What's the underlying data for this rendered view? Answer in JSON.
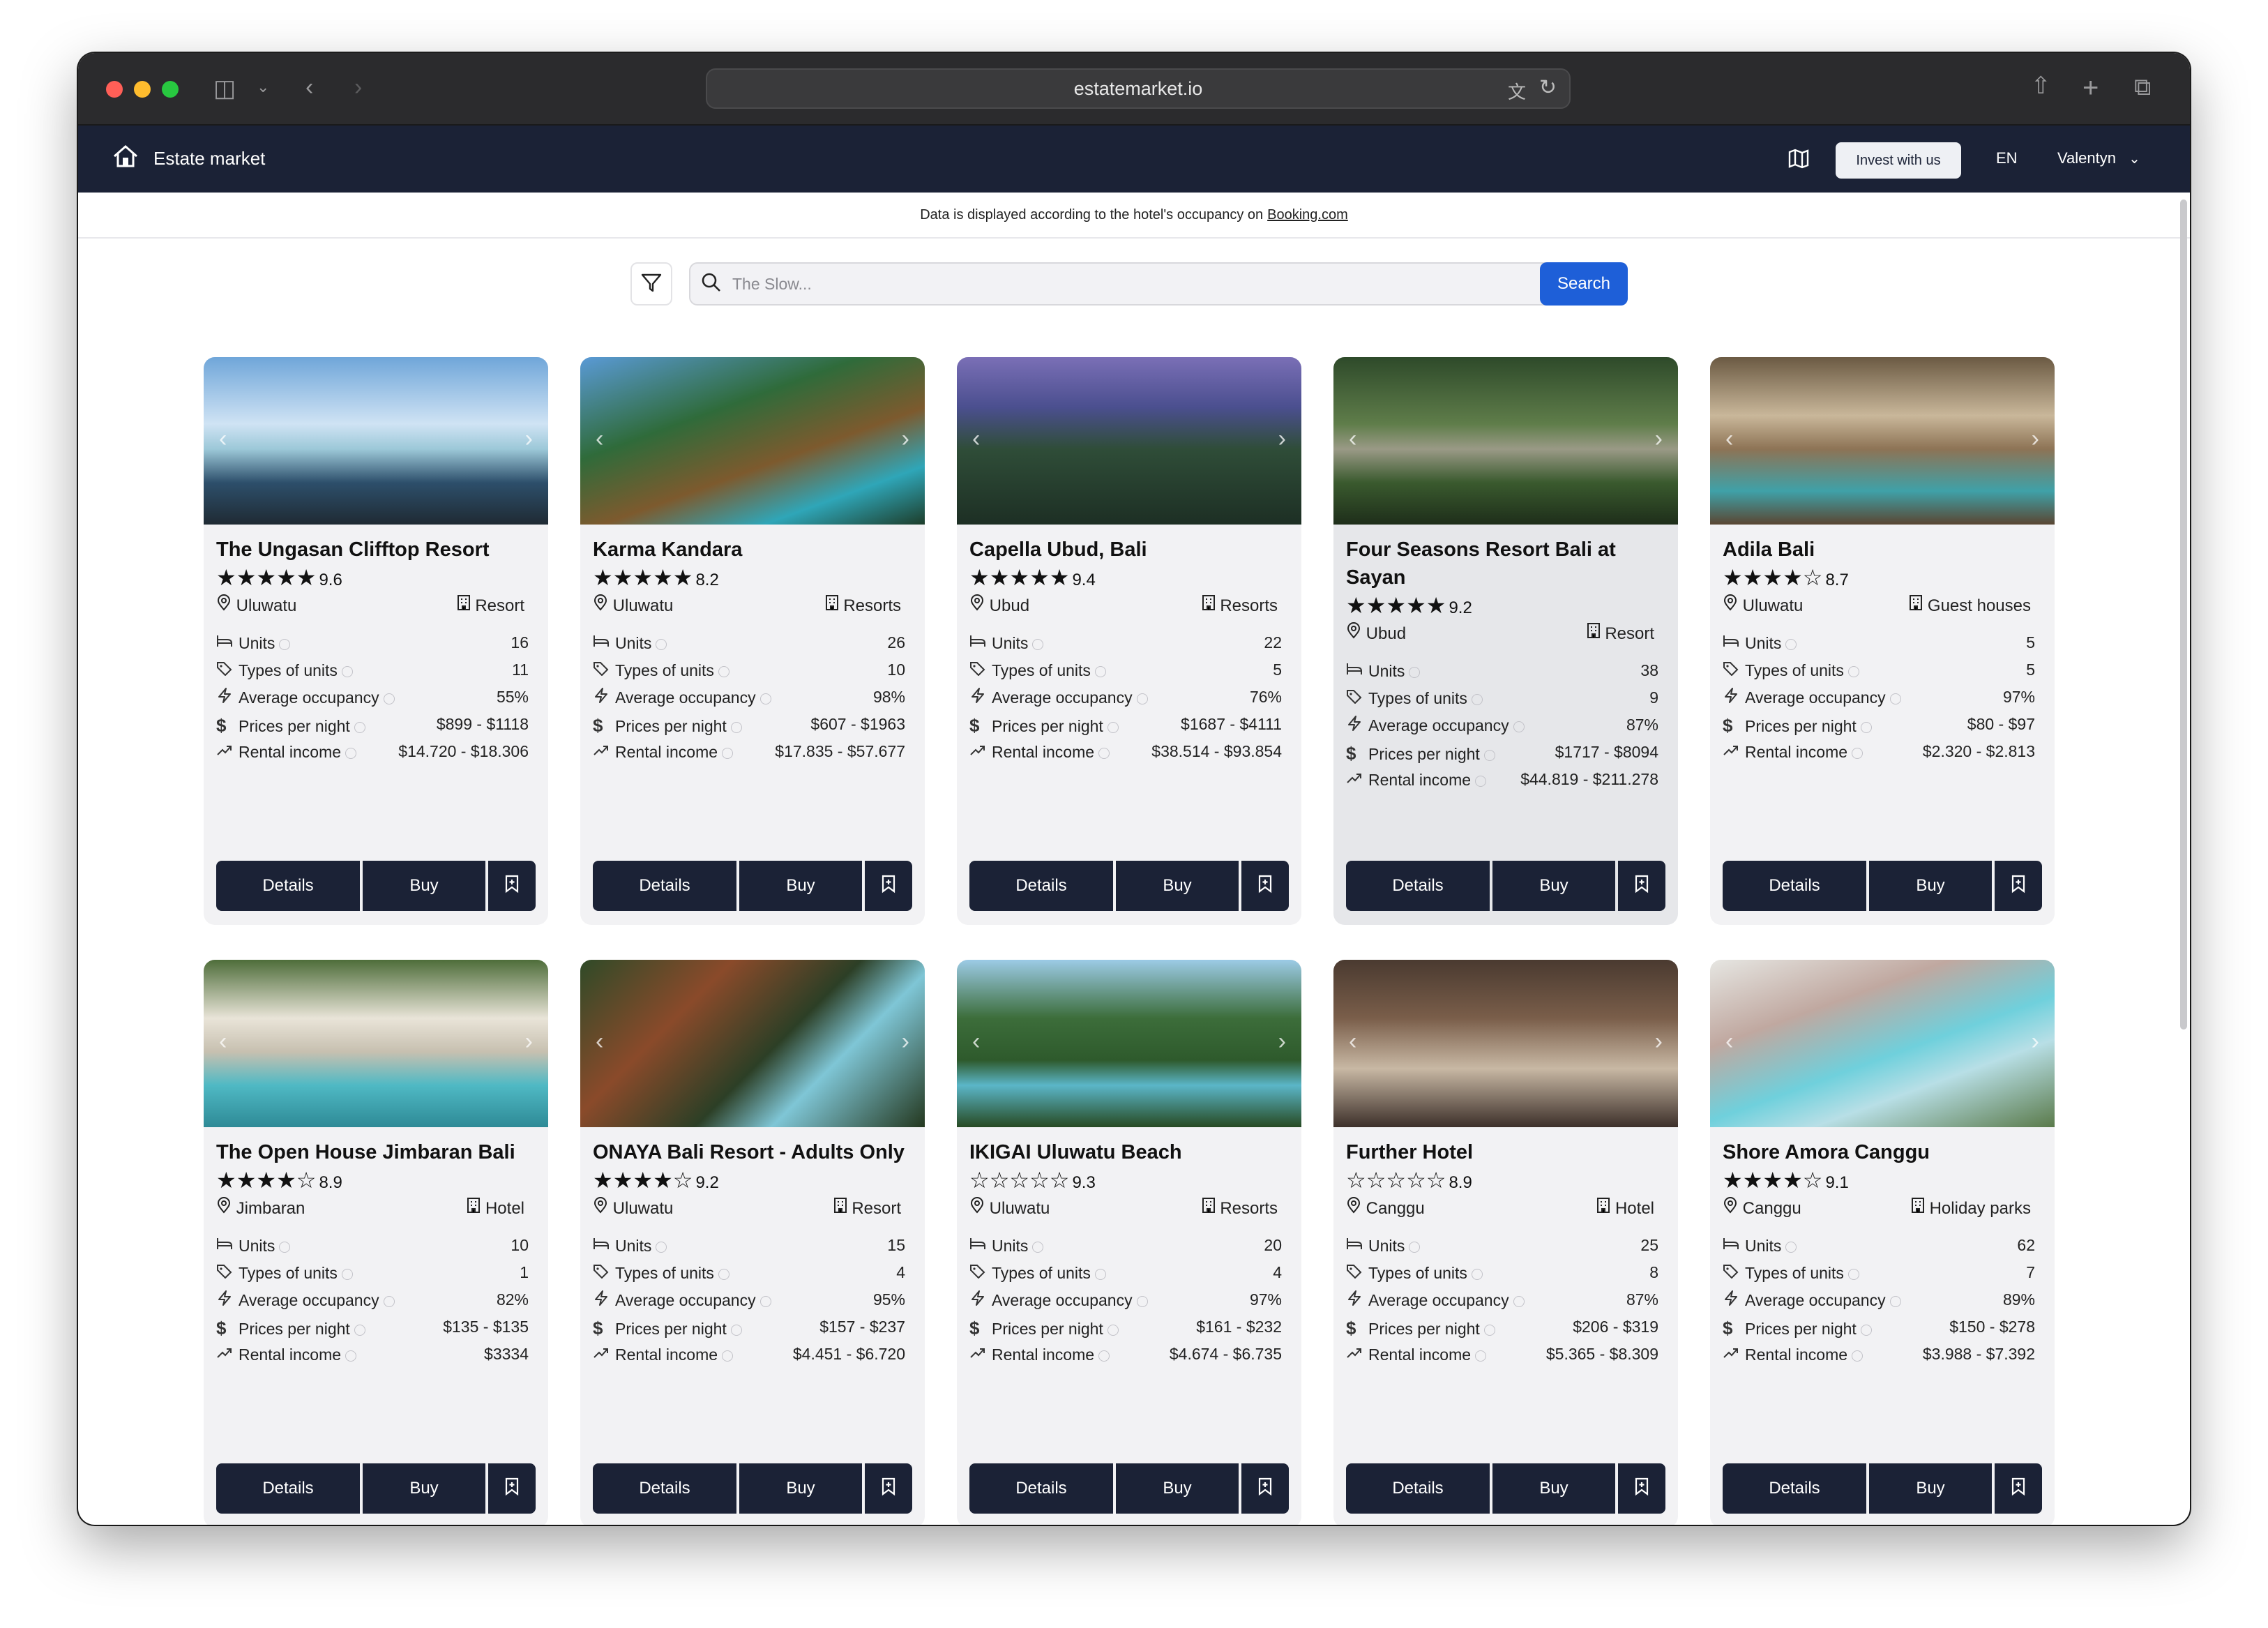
{
  "browser": {
    "url": "estatemarket.io",
    "colors": {
      "red": "#ff5f57",
      "yellow": "#febc2e",
      "green": "#28c840"
    }
  },
  "nav": {
    "brand": "Estate market",
    "invest_label": "Invest with us",
    "language": "EN",
    "user": "Valentyn"
  },
  "notice": {
    "text": "Data is displayed according to the hotel's occupancy on",
    "link": "Booking.com"
  },
  "search": {
    "placeholder": "The Slow...",
    "button": "Search"
  },
  "labels": {
    "units": "Units",
    "types": "Types of units",
    "occupancy": "Average occupancy",
    "prices": "Prices per night",
    "income": "Rental income",
    "details": "Details",
    "buy": "Buy"
  },
  "listings": [
    {
      "title": "The Ungasan Clifftop Resort",
      "stars": 5,
      "rating": "9.6",
      "location": "Uluwatu",
      "type": "Resort",
      "units": "16",
      "types": "11",
      "occupancy": "55%",
      "prices": "$899 - $1118",
      "income": "$14.720 - $18.306",
      "highlighted": false
    },
    {
      "title": "Karma Kandara",
      "stars": 5,
      "rating": "8.2",
      "location": "Uluwatu",
      "type": "Resorts",
      "units": "26",
      "types": "10",
      "occupancy": "98%",
      "prices": "$607 - $1963",
      "income": "$17.835 - $57.677",
      "highlighted": false
    },
    {
      "title": "Capella Ubud, Bali",
      "stars": 5,
      "rating": "9.4",
      "location": "Ubud",
      "type": "Resorts",
      "units": "22",
      "types": "5",
      "occupancy": "76%",
      "prices": "$1687 - $4111",
      "income": "$38.514 - $93.854",
      "highlighted": false
    },
    {
      "title": "Four Seasons Resort Bali at Sayan",
      "stars": 5,
      "rating": "9.2",
      "location": "Ubud",
      "type": "Resort",
      "units": "38",
      "types": "9",
      "occupancy": "87%",
      "prices": "$1717 - $8094",
      "income": "$44.819 - $211.278",
      "highlighted": true
    },
    {
      "title": "Adila Bali",
      "stars": 4,
      "rating": "8.7",
      "location": "Uluwatu",
      "type": "Guest houses",
      "units": "5",
      "types": "5",
      "occupancy": "97%",
      "prices": "$80 - $97",
      "income": "$2.320 - $2.813",
      "highlighted": false
    },
    {
      "title": "The Open House Jimbaran Bali",
      "stars": 4,
      "rating": "8.9",
      "location": "Jimbaran",
      "type": "Hotel",
      "units": "10",
      "types": "1",
      "occupancy": "82%",
      "prices": "$135 - $135",
      "income": "$3334",
      "highlighted": false
    },
    {
      "title": "ONAYA Bali Resort - Adults Only",
      "stars": 4,
      "rating": "9.2",
      "location": "Uluwatu",
      "type": "Resort",
      "units": "15",
      "types": "4",
      "occupancy": "95%",
      "prices": "$157 - $237",
      "income": "$4.451 - $6.720",
      "highlighted": false
    },
    {
      "title": "IKIGAI Uluwatu Beach",
      "stars": 0,
      "rating": "9.3",
      "location": "Uluwatu",
      "type": "Resorts",
      "units": "20",
      "types": "4",
      "occupancy": "97%",
      "prices": "$161 - $232",
      "income": "$4.674 - $6.735",
      "highlighted": false
    },
    {
      "title": "Further Hotel",
      "stars": 0,
      "rating": "8.9",
      "location": "Canggu",
      "type": "Hotel",
      "units": "25",
      "types": "8",
      "occupancy": "87%",
      "prices": "$206 - $319",
      "income": "$5.365 - $8.309",
      "highlighted": false
    },
    {
      "title": "Shore Amora Canggu",
      "stars": 4,
      "rating": "9.1",
      "location": "Canggu",
      "type": "Holiday parks",
      "units": "62",
      "types": "7",
      "occupancy": "89%",
      "prices": "$150 - $278",
      "income": "$3.988 - $7.392",
      "highlighted": false
    }
  ]
}
